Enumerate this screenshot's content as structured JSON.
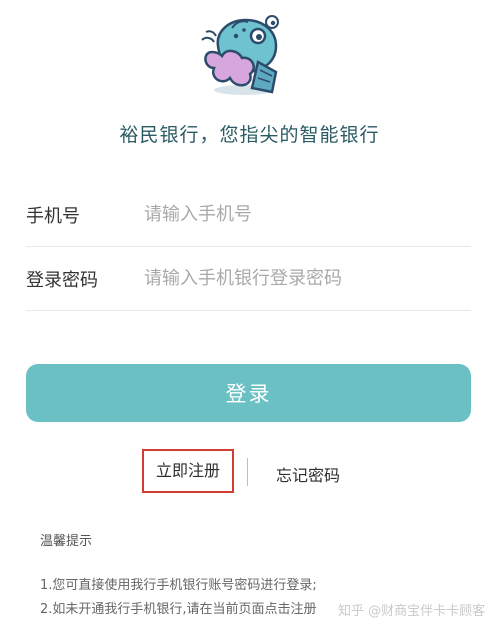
{
  "app": {
    "slogan": "裕民银行，您指尖的智能银行"
  },
  "form": {
    "phone_label": "手机号",
    "phone_placeholder": "请输入手机号",
    "phone_value": "",
    "password_label": "登录密码",
    "password_placeholder": "请输入手机银行登录密码",
    "password_value": ""
  },
  "actions": {
    "login_label": "登录",
    "register_label": "立即注册",
    "forgot_label": "忘记密码"
  },
  "tips": {
    "title": "温馨提示",
    "items": [
      "1.您可直接使用我行手机银行账号密码进行登录;",
      "2.如未开通我行手机银行,请在当前页面点击注册"
    ]
  },
  "watermark": "知乎 @财商宝伴卡卡顾客",
  "colors": {
    "accent": "#6bc0c4",
    "slogan": "#2a5b63",
    "highlight_border": "#d33c32",
    "placeholder": "#a9a9a9"
  },
  "icons": {
    "logo": "cartoon-mascot-logo"
  }
}
